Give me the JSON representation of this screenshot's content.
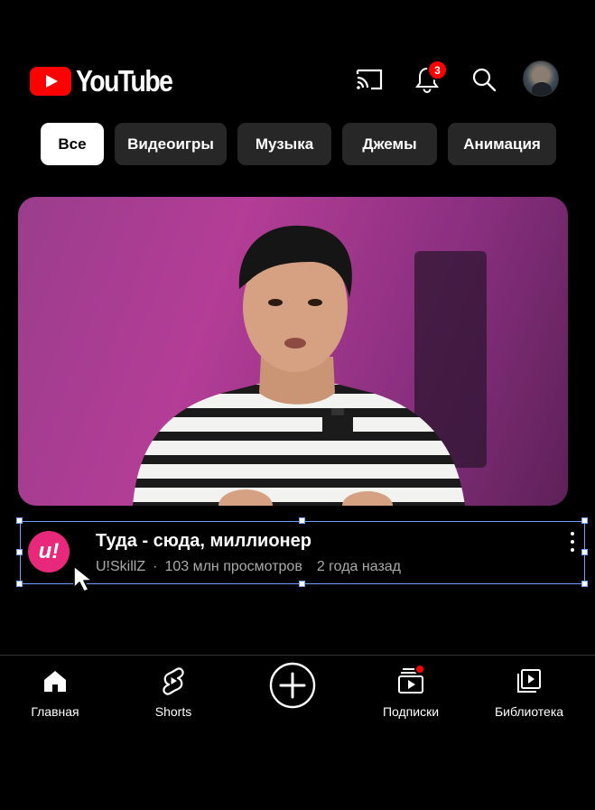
{
  "header": {
    "logo_text": "YouTube",
    "notification_count": "3",
    "icons": [
      "cast-icon",
      "bell-icon",
      "search-icon",
      "avatar"
    ]
  },
  "chips": [
    {
      "label": "Все",
      "active": true
    },
    {
      "label": "Видеоигры",
      "active": false
    },
    {
      "label": "Музыка",
      "active": false
    },
    {
      "label": "Джемы",
      "active": false
    },
    {
      "label": "Анимация",
      "active": false
    }
  ],
  "video": {
    "title": "Туда - сюда, миллионер",
    "channel": "U!SkillZ",
    "channel_avatar_text": "u!",
    "views": "103 млн просмотров",
    "age": "2 года назад",
    "separator": "·"
  },
  "bottom_nav": [
    {
      "label": "Главная",
      "icon": "home-icon"
    },
    {
      "label": "Shorts",
      "icon": "shorts-icon"
    },
    {
      "label": "",
      "icon": "create-icon"
    },
    {
      "label": "Подписки",
      "icon": "subscriptions-icon"
    },
    {
      "label": "Библиотека",
      "icon": "library-icon"
    }
  ],
  "colors": {
    "brand_red": "#ff0000",
    "chip_bg": "#272727",
    "selection_blue": "#6fa2ff",
    "channel_pink": "#e8287a"
  }
}
